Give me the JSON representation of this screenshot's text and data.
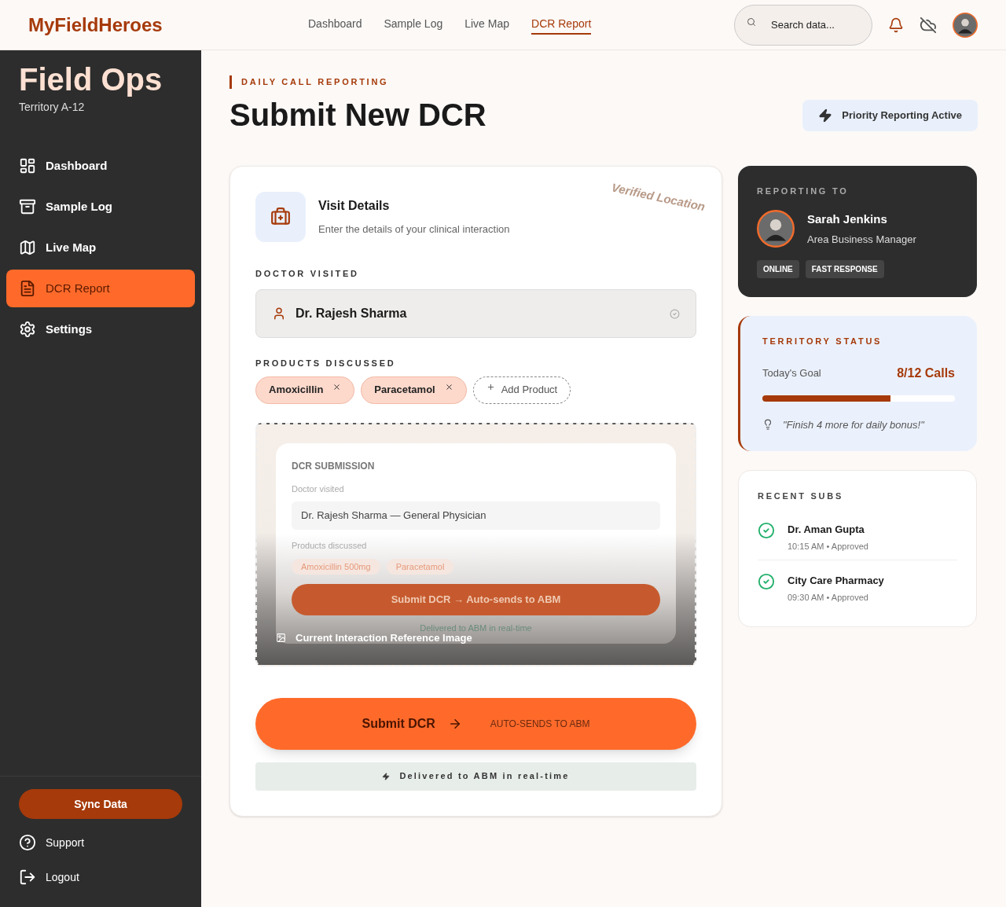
{
  "brand": "MyFieldHeroes",
  "top_nav": [
    {
      "label": "Dashboard",
      "selected": false
    },
    {
      "label": "Sample Log",
      "selected": false
    },
    {
      "label": "Live Map",
      "selected": false
    },
    {
      "label": "DCR Report",
      "selected": true
    }
  ],
  "search": {
    "placeholder": "Search data..."
  },
  "sidebar": {
    "title": "Field Ops",
    "subtitle": "Territory A-12",
    "items": [
      {
        "label": "Dashboard",
        "selected": false
      },
      {
        "label": "Sample Log",
        "selected": false
      },
      {
        "label": "Live Map",
        "selected": false
      },
      {
        "label": "DCR Report",
        "selected": true
      },
      {
        "label": "Settings",
        "selected": false
      }
    ],
    "sync_button": "Sync Data",
    "footer": [
      "Support",
      "Logout"
    ]
  },
  "page": {
    "eyebrow": "DAILY CALL REPORTING",
    "title": "Submit New DCR",
    "badge": "Priority Reporting Active"
  },
  "form": {
    "stamp": "Verified Location",
    "title": "Visit Details",
    "subtitle": "Enter the details of your clinical interaction",
    "doctor_label": "DOCTOR VISITED",
    "doctor_value": "Dr. Rajesh Sharma",
    "products_label": "PRODUCTS DISCUSSED",
    "products": [
      "Amoxicillin",
      "Paracetamol"
    ],
    "add_product": "Add Product",
    "reference": {
      "heading": "DCR SUBMISSION",
      "doctor_label": "Doctor visited",
      "doctor_value": "Dr. Rajesh Sharma — General Physician",
      "products_label": "Products discussed",
      "products": [
        "Amoxicillin 500mg",
        "Paracetamol"
      ],
      "button": "Submit DCR → Auto-sends to ABM",
      "note": "Delivered to ABM in real-time",
      "caption": "Current Interaction Reference Image"
    },
    "submit": "Submit DCR",
    "submit_note": "AUTO-SENDS TO ABM",
    "delivered": "Delivered to ABM in real-time"
  },
  "reporting": {
    "label": "REPORTING TO",
    "name": "Sarah Jenkins",
    "role": "Area Business Manager",
    "tags": [
      "ONLINE",
      "FAST RESPONSE"
    ]
  },
  "territory": {
    "label": "TERRITORY STATUS",
    "goal_label": "Today's Goal",
    "goal_value": "8/12 Calls",
    "level": 0.667,
    "tip": "\"Finish 4 more for daily bonus!\""
  },
  "recent": {
    "label": "RECENT SUBS",
    "items": [
      {
        "name": "Dr. Aman Gupta",
        "meta": "10:15 AM • Approved"
      },
      {
        "name": "City Care Pharmacy",
        "meta": "09:30 AM • Approved"
      }
    ]
  }
}
